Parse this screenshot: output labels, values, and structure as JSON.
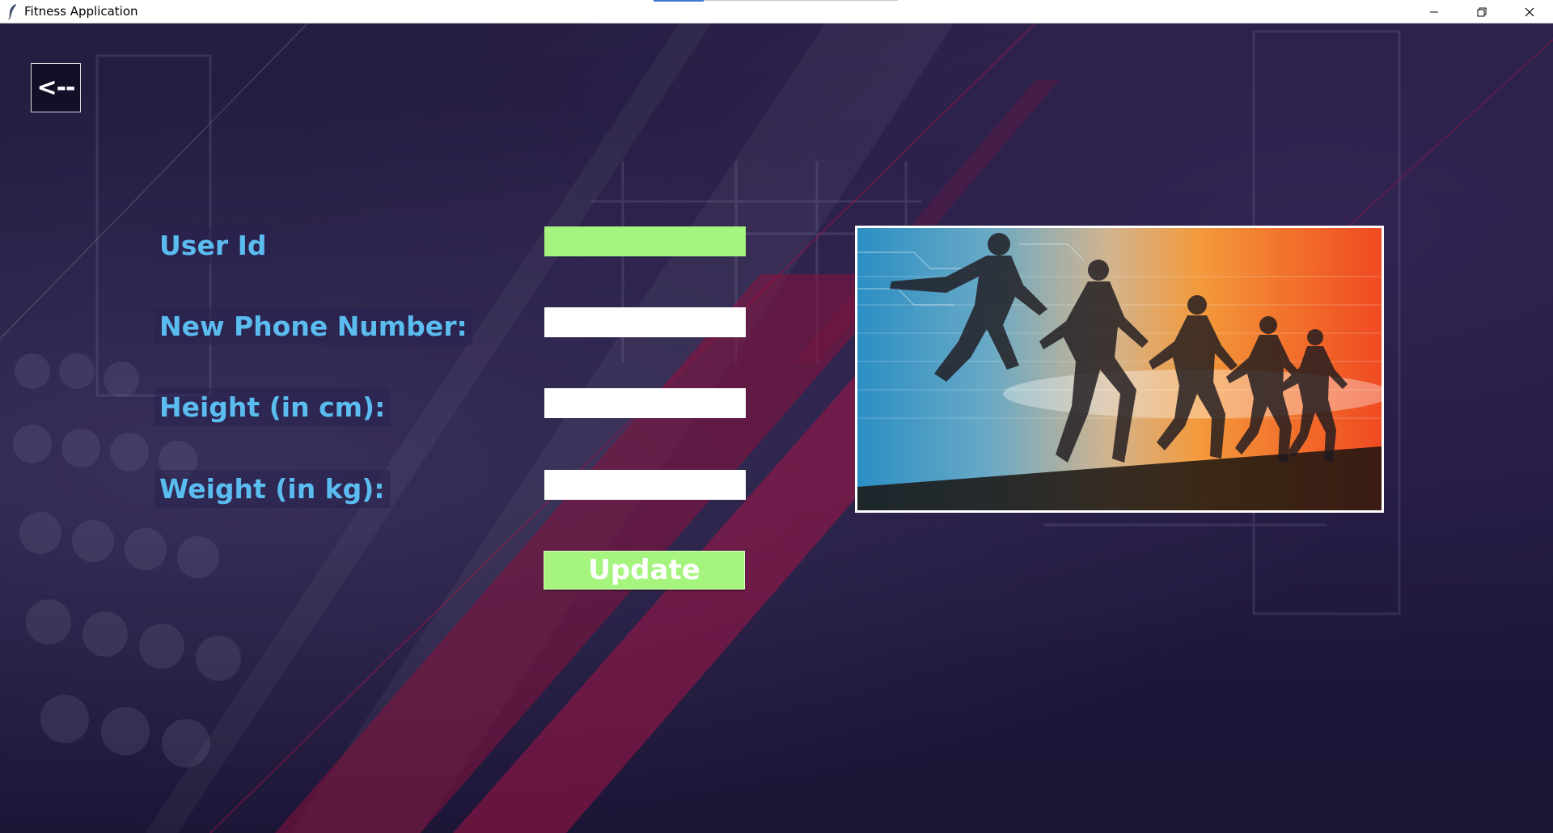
{
  "window": {
    "title": "Fitness Application",
    "controls": [
      "minimize-icon",
      "restore-icon",
      "close-icon"
    ]
  },
  "back_button": {
    "label": "<--"
  },
  "form": {
    "user_id": {
      "label": "User Id",
      "value": ""
    },
    "phone": {
      "label": "New Phone Number:",
      "value": ""
    },
    "height": {
      "label": "Height (in cm):",
      "value": ""
    },
    "weight": {
      "label": "Weight (in kg):",
      "value": ""
    },
    "update_label": "Update"
  },
  "colors": {
    "label_blue": "#5bbcf0",
    "accent_green": "#a4f47e",
    "background_purple": "#241c42",
    "stripe_crimson": "#a2133f"
  },
  "icons": {
    "app": "feather-icon",
    "image": "runners-silhouette-image"
  }
}
